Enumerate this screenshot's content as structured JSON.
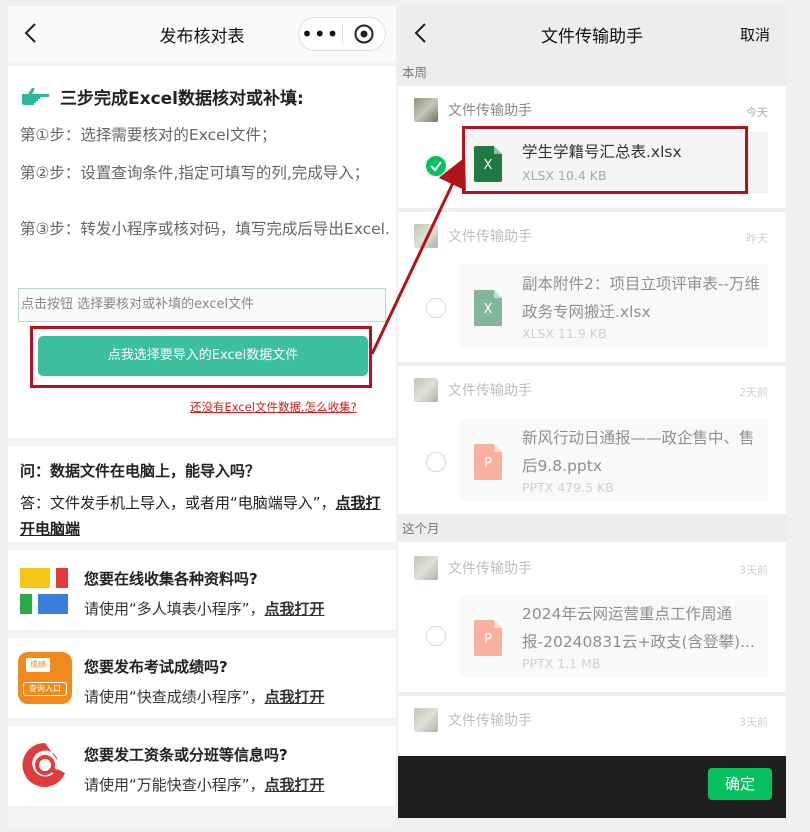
{
  "left": {
    "nav_title": "发布核对表",
    "capsule_dots": "•••",
    "heading": "三步完成Excel数据核对或补填:",
    "step1": "第①步：选择需要核对的Excel文件；",
    "step2": "第②步：设置查询条件,指定可填写的列,完成导入；",
    "step3": "第③步：转发小程序或核对码，填写完成后导出Excel.",
    "input_placeholder": "点击按钮 选择要核对或补填的excel文件",
    "import_button": "点我选择要导入的Excel数据文件",
    "no_data_link": "还没有Excel文件数据,怎么收集?",
    "faq_q": "问：数据文件在电脑上，能导入吗？",
    "faq_a_prefix": "答：文件发手机上导入，或者用“电脑端导入”，",
    "faq_a_link": "点我打开电脑端",
    "promos": [
      {
        "title": "您要在线收集各种资料吗?",
        "text": "请使用“多人填表小程序”，",
        "link": "点我打开"
      },
      {
        "title": "您要发布考试成绩吗?",
        "text": "请使用“快查成绩小程序”，",
        "link": "点我打开",
        "icon_top": "成绩",
        "icon_bottom": "查询入口"
      },
      {
        "title": "您要发工资条或分班等信息吗?",
        "text": "请使用“万能快查小程序”，",
        "link": "点我打开"
      }
    ]
  },
  "right": {
    "nav_title": "文件传输助手",
    "cancel": "取消",
    "section_week": "本周",
    "section_month": "这个月",
    "confirm": "确定",
    "items": [
      {
        "sender": "文件传输助手",
        "when": "今天",
        "name": "学生学籍号汇总表.xlsx",
        "meta": "XLSX 10.4 KB",
        "type": "X",
        "checked": true
      },
      {
        "sender": "文件传输助手",
        "when": "昨天",
        "name": "副本附件2：项目立项评审表--万维政务专网搬迁.xlsx",
        "meta": "XLSX 11.9 KB",
        "type": "X",
        "checked": false
      },
      {
        "sender": "文件传输助手",
        "when": "2天前",
        "name": "新风行动日通报——政企售中、售后9.8.pptx",
        "meta": "PPTX 479.5 KB",
        "type": "P",
        "checked": false
      },
      {
        "sender": "文件传输助手",
        "when": "3天前",
        "name": "2024年云网运营重点工作周通报-20240831云+政支(含登攀)...",
        "meta": "PPTX 1.1 MB",
        "type": "P",
        "checked": false
      },
      {
        "sender": "文件传输助手",
        "when": "3天前"
      }
    ]
  },
  "colors": {
    "accent": "#3bbf9f",
    "wechat_green": "#07c160",
    "highlight_red": "#b0141b",
    "excel_green": "#1d7a45",
    "ppt_orange": "#f0714d"
  }
}
